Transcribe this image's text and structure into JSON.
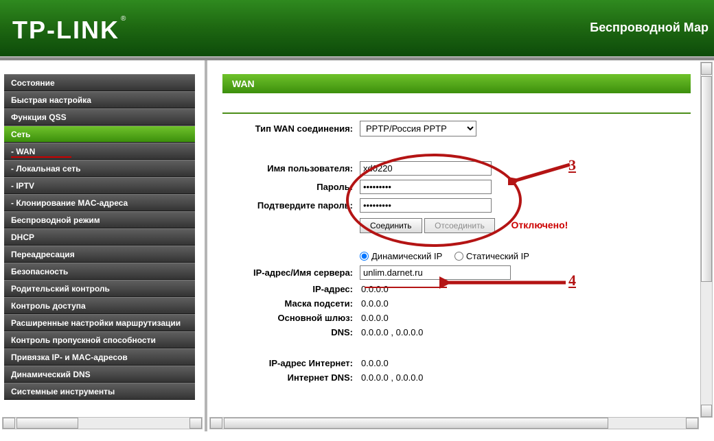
{
  "header": {
    "logo": "TP-LINK",
    "product": "Беспроводной Мар"
  },
  "sidebar": {
    "items": [
      {
        "label": "Состояние"
      },
      {
        "label": "Быстрая настройка"
      },
      {
        "label": "Функция QSS"
      },
      {
        "label": "Сеть",
        "active": true
      },
      {
        "label": "- WAN",
        "wan": true
      },
      {
        "label": "- Локальная сеть"
      },
      {
        "label": "- IPTV"
      },
      {
        "label": "- Клонирование MAC-адреса"
      },
      {
        "label": "Беспроводной режим"
      },
      {
        "label": "DHCP"
      },
      {
        "label": "Переадресация"
      },
      {
        "label": "Безопасность"
      },
      {
        "label": "Родительский контроль"
      },
      {
        "label": "Контроль доступа"
      },
      {
        "label": "Расширенные настройки маршрутизации"
      },
      {
        "label": "Контроль пропускной способности"
      },
      {
        "label": "Привязка IP- и MAC-адресов"
      },
      {
        "label": "Динамический DNS"
      },
      {
        "label": "Системные инструменты"
      }
    ]
  },
  "panel": {
    "title": "WAN"
  },
  "form": {
    "conn_type_label": "Тип WAN соединения:",
    "conn_type_value": "PPTP/Россия PPTP",
    "user_label": "Имя пользователя:",
    "user_value": "xd0220",
    "pass_label": "Пароль:",
    "pass_value": "•••••••••",
    "pass2_label": "Подтвердите пароль:",
    "pass2_value": "•••••••••",
    "connect_btn": "Соединить",
    "disconnect_btn": "Отсоединить",
    "status": "Отключено!",
    "dyn_label": "Динамический IP",
    "stat_label": "Статический IP",
    "srv_label": "IP-адрес/Имя сервера:",
    "srv_value": "unlim.darnet.ru",
    "ip_label": "IP-адрес:",
    "ip_value": "0.0.0.0",
    "mask_label": "Маска подсети:",
    "mask_value": "0.0.0.0",
    "gw_label": "Основной шлюз:",
    "gw_value": "0.0.0.0",
    "dns_label": "DNS:",
    "dns_value": "0.0.0.0 , 0.0.0.0",
    "wan_ip_label": "IP-адрес Интернет:",
    "wan_ip_value": "0.0.0.0",
    "wan_dns_label": "Интернет DNS:",
    "wan_dns_value": "0.0.0.0 , 0.0.0.0"
  },
  "annot": {
    "c3": "3",
    "c4": "4"
  }
}
